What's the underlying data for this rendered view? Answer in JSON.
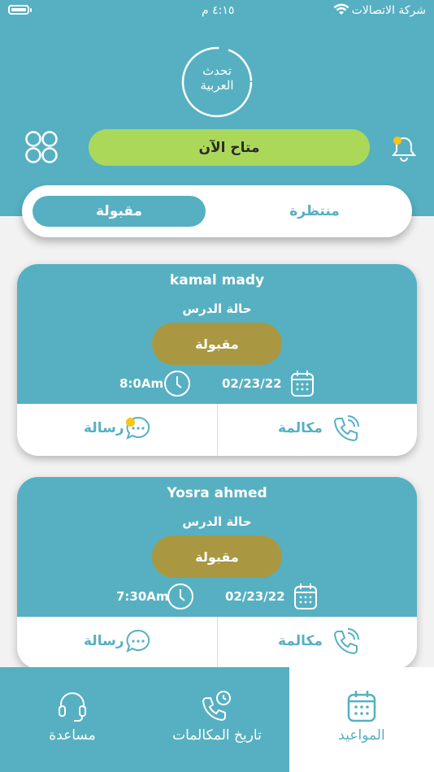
{
  "status_bar": {
    "carrier": "شركة الاتصالات",
    "time": "٤:١٥ م"
  },
  "logo": {
    "line1": "تحدث",
    "line2": "العربية"
  },
  "header": {
    "availability_label": "متاح الآن"
  },
  "tabs": {
    "waiting": "منتظرة",
    "accepted": "مقبولة",
    "selected": "accepted"
  },
  "cards": [
    {
      "name": "kamal mady",
      "status_label": "حالة الدرس",
      "status_value": "مقبولة",
      "date": "02/23/22",
      "time": "8:0Am",
      "call_label": "مكالمة",
      "message_label": "رسالة",
      "has_unread": true
    },
    {
      "name": "Yosra ahmed",
      "status_label": "حالة الدرس",
      "status_value": "مقبولة",
      "date": "02/23/22",
      "time": "7:30Am",
      "call_label": "مكالمة",
      "message_label": "رسالة",
      "has_unread": false
    }
  ],
  "bottom_nav": {
    "appointments": "المواعيد",
    "call_history": "تاريخ المكالمات",
    "help": "مساعدة",
    "active": "appointments"
  },
  "colors": {
    "primary": "#56b0c2",
    "available": "#acd85a",
    "accepted_pill": "#a99841",
    "notification_dot": "#f5c518"
  }
}
